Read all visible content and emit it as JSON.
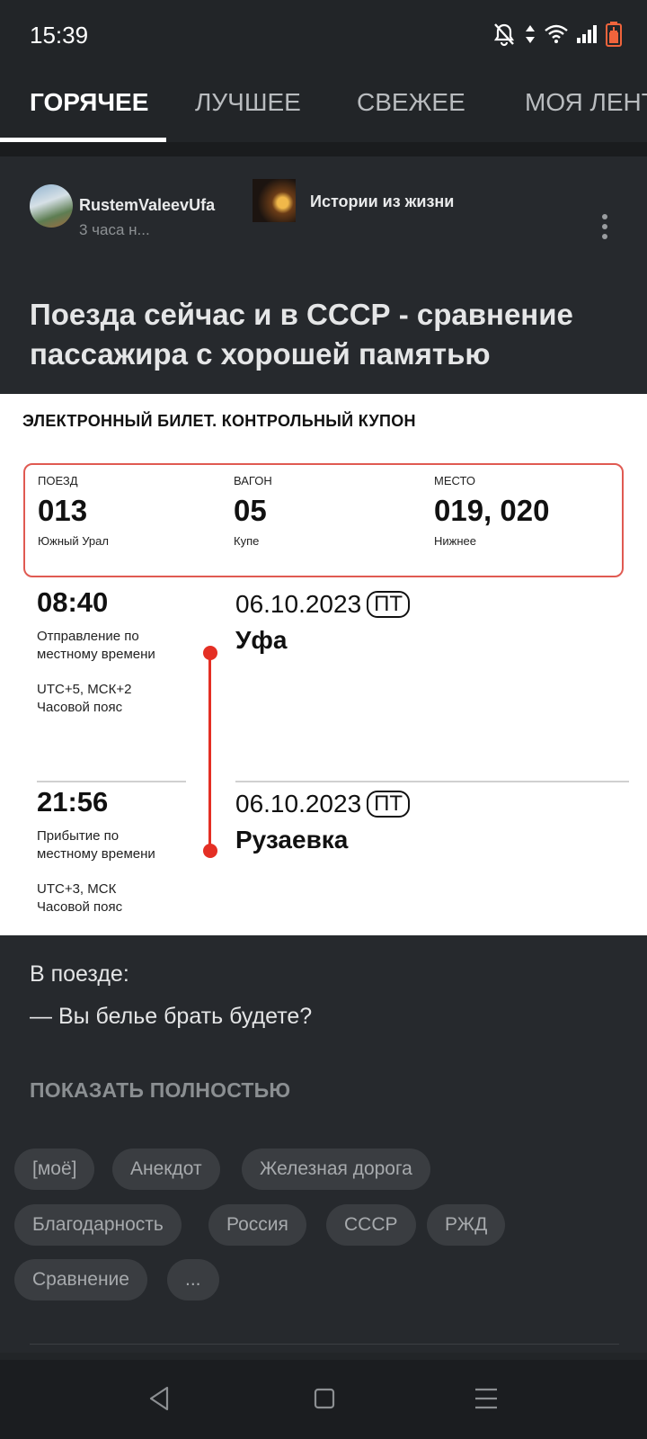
{
  "status_bar": {
    "time": "15:39"
  },
  "tabs": [
    {
      "label": "ГОРЯЧЕЕ",
      "active": true
    },
    {
      "label": "ЛУЧШЕЕ"
    },
    {
      "label": "СВЕЖЕЕ"
    },
    {
      "label": "МОЯ ЛЕНТА"
    }
  ],
  "post": {
    "author": "RustemValeevUfa",
    "time": "3 часа н...",
    "community": "Истории из жизни",
    "title": "Поезда сейчас и в СССР - сравнение пассажира с хорошей памятью",
    "body_lines": [
      "В поезде:",
      "— Вы белье брать будете?"
    ],
    "show_full": "ПОКАЗАТЬ ПОЛНОСТЬЮ",
    "tags": [
      "[моё]",
      "Анекдот",
      "Железная дорога",
      "Благодарность",
      "Россия",
      "СССР",
      "РЖД",
      "Сравнение",
      "..."
    ]
  },
  "ticket": {
    "header": "ЭЛЕКТРОННЫЙ БИЛЕТ. КОНТРОЛЬНЫЙ КУПОН",
    "train_label": "ПОЕЗД",
    "train": "013",
    "train_name": "Южный Урал",
    "car_label": "ВАГОН",
    "car": "05",
    "car_type": "Купе",
    "seat_label": "МЕСТО",
    "seat": "019, 020",
    "seat_type": "Нижнее",
    "dep_time": "08:40",
    "dep_desc_1": "Отправление по",
    "dep_desc_2": "местному времени",
    "dep_tz_1": "UTC+5, МСК+2",
    "dep_tz_2": "Часовой пояс",
    "dep_date": "06.10.2023",
    "dep_day": "ПТ",
    "dep_city": "Уфа",
    "arr_time": "21:56",
    "arr_desc_1": "Прибытие по",
    "arr_desc_2": "местному времени",
    "arr_tz_1": "UTC+3, МСК",
    "arr_tz_2": "Часовой пояс",
    "arr_date": "06.10.2023",
    "arr_day": "ПТ",
    "arr_city": "Рузаевка"
  },
  "colors": {
    "background": "#222528",
    "card": "#26292d",
    "accent_red": "#e42f24"
  },
  "icons": [
    "bell-off-icon",
    "data-arrows-icon",
    "wifi-icon",
    "signal-icon",
    "battery-low-icon",
    "more-vertical-icon",
    "nav-back-icon",
    "nav-home-icon",
    "nav-menu-icon"
  ]
}
